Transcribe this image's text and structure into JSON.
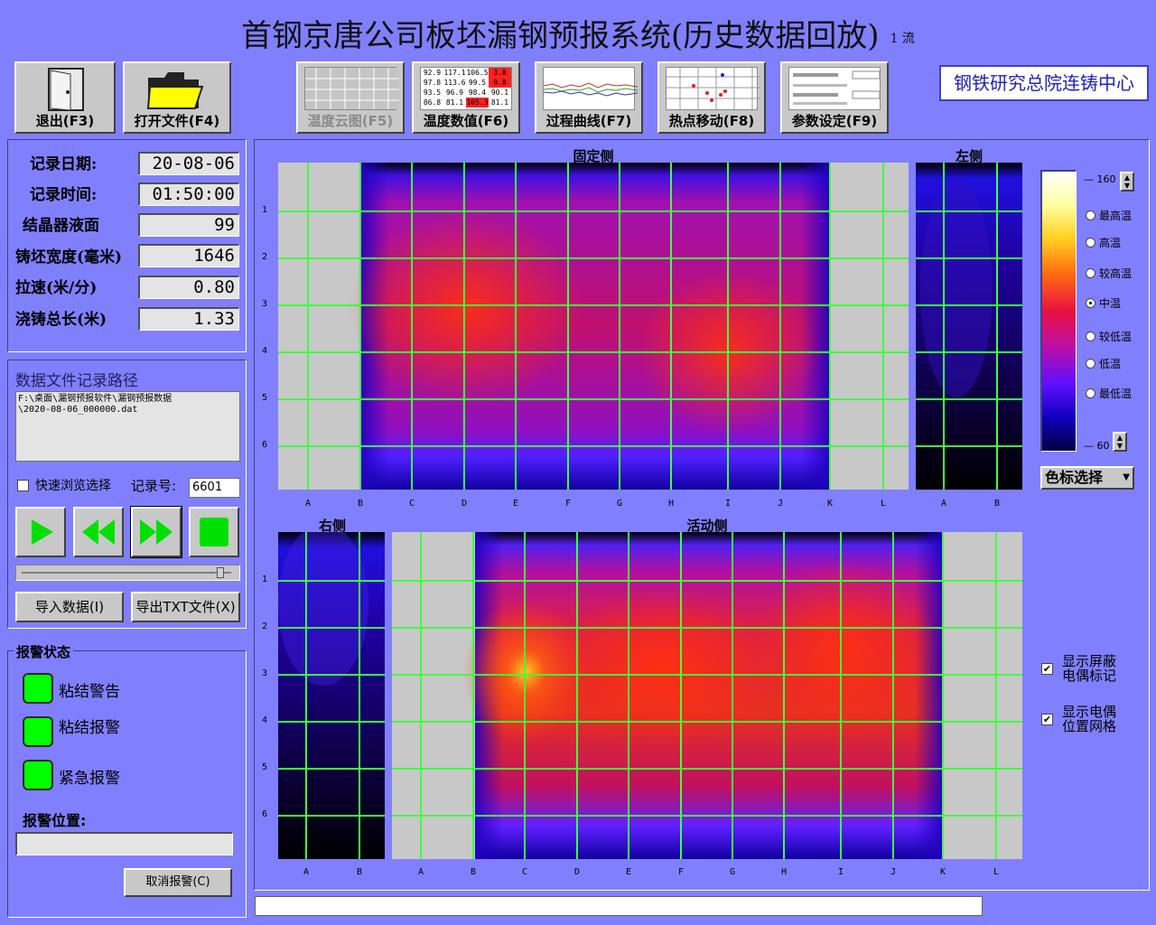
{
  "title": "首钢京唐公司板坯漏钢预报系统(历史数据回放)",
  "flow_label": "1 流",
  "brand": "钢铁研究总院连铸中心",
  "toolbar": {
    "exit": "退出(F3)",
    "open": "打开文件(F4)",
    "cloud": "温度云图(F5)",
    "values": "温度数值(F6)",
    "curve": "过程曲线(F7)",
    "hotspot": "热点移动(F8)",
    "params": "参数设定(F9)"
  },
  "thumb_values": [
    [
      "92.9",
      "117.1",
      "106.5",
      "3.8"
    ],
    [
      "97.8",
      "113.6",
      "99.5",
      "9.8"
    ],
    [
      "93.5",
      "96.9",
      "98.4",
      "90.1"
    ],
    [
      "86.8",
      "81.1",
      "105.3",
      "81.1"
    ]
  ],
  "info": {
    "date_label": "记录日期:",
    "date": "20-08-06",
    "time_label": "记录时间:",
    "time": "01:50:00",
    "level_label": "结晶器液面",
    "level": "99",
    "width_label": "铸坯宽度(毫米)",
    "width": "1646",
    "speed_label": "拉速(米/分)",
    "speed": "0.80",
    "length_label": "浇铸总长(米)",
    "length": "1.33"
  },
  "file": {
    "header": "数据文件记录路径",
    "path_line1": "F:\\桌面\\漏钢预报软件\\漏钢预报数据",
    "path_line2": "\\2020-08-06_000000.dat",
    "quick_label": "快速浏览选择",
    "record_label": "记录号:",
    "record_no": "6601",
    "import": "导入数据(I)",
    "export": "导出TXT文件(X)"
  },
  "alarm": {
    "header": "报警状态",
    "items": [
      "粘结警告",
      "粘结报警",
      "紧急报警"
    ],
    "pos_label": "报警位置:",
    "pos_value": "",
    "cancel": "取消报警(C)"
  },
  "panels": {
    "fixed": "固定侧",
    "left": "左侧",
    "right": "右侧",
    "moving": "活动侧"
  },
  "rows": [
    "1",
    "2",
    "3",
    "4",
    "5",
    "6"
  ],
  "fixed_cols": [
    "A",
    "B",
    "C",
    "D",
    "E",
    "F",
    "G",
    "H",
    "I",
    "J",
    "K",
    "L"
  ],
  "moving_cols": [
    "A",
    "B",
    "C",
    "D",
    "E",
    "F",
    "G",
    "H",
    "I",
    "J",
    "K",
    "L"
  ],
  "narrow_cols": [
    "A",
    "B"
  ],
  "scale": {
    "max": "160",
    "min": "60",
    "levels": [
      "最高温",
      "高温",
      "较高温",
      "中温",
      "较低温",
      "低温",
      "最低温"
    ],
    "selected_level": "中温",
    "select_label": "色标选择"
  },
  "options": {
    "shield": "显示屏蔽电偶标记",
    "grid": "显示电偶位置网格"
  },
  "colors": {
    "background": "#8080ff",
    "grid": "#40ff40",
    "led": "#00ff00"
  }
}
